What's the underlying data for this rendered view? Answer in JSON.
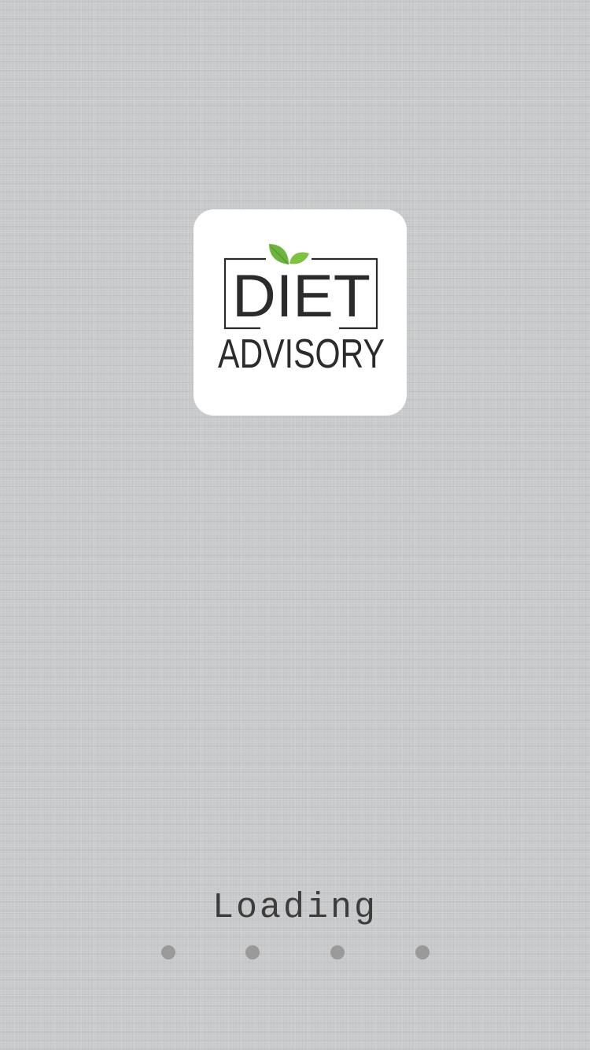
{
  "app": {
    "logo": {
      "line1": "DIET",
      "line2": "ADVISORY",
      "leaf_color": "#6cb33f",
      "text_color": "#2b2b2b",
      "card_color": "#ffffff"
    },
    "loading": {
      "label": "Loading",
      "dot_count": 4,
      "dot_color": "#9a9a9b"
    },
    "background_color": "#c9cacb"
  }
}
